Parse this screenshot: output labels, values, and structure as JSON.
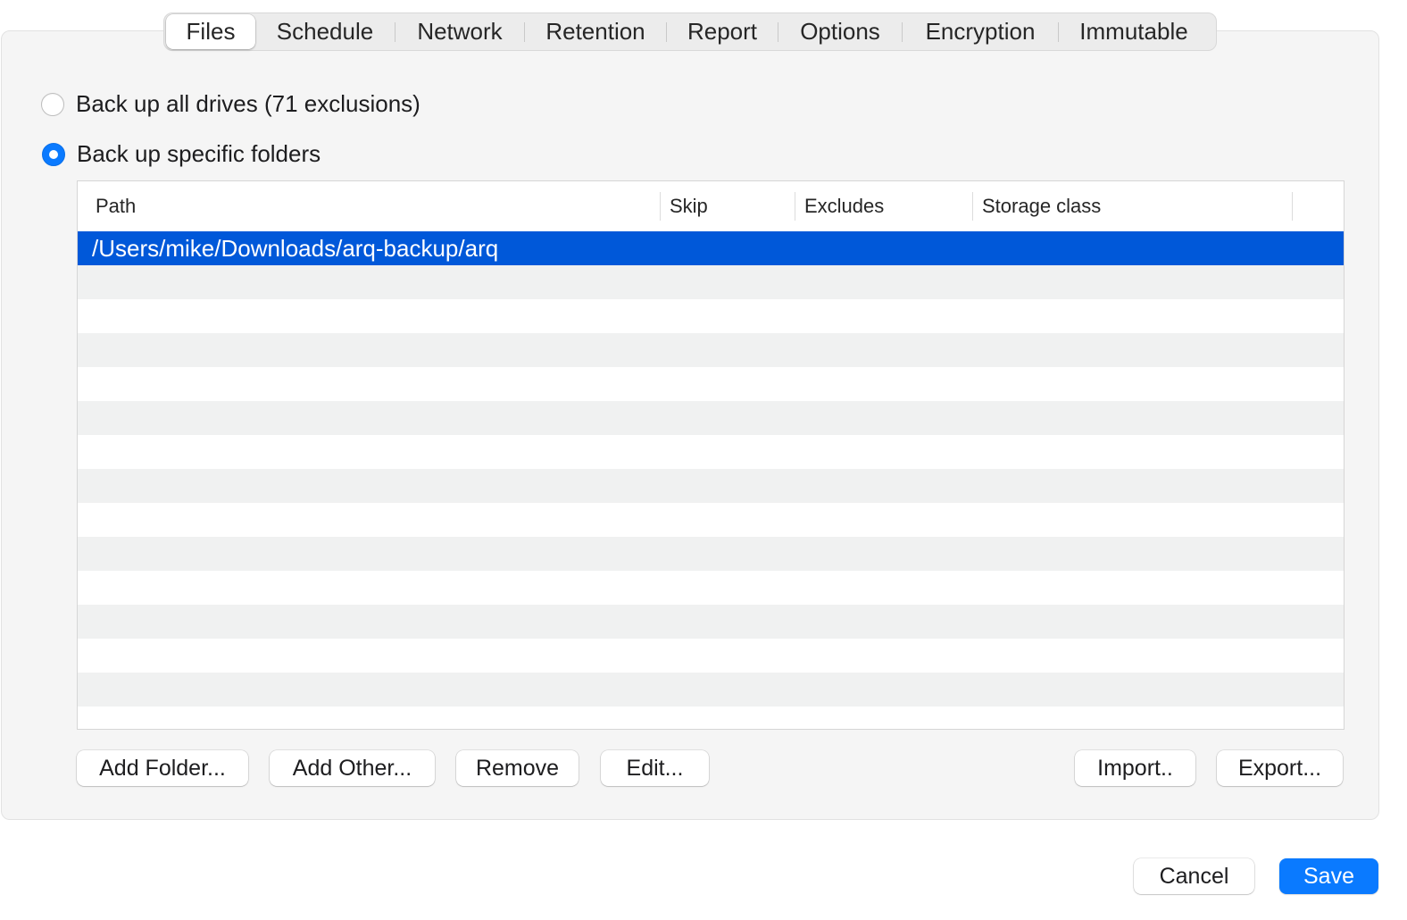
{
  "tabs": [
    {
      "label": "Files",
      "selected": true
    },
    {
      "label": "Schedule",
      "selected": false
    },
    {
      "label": "Network",
      "selected": false
    },
    {
      "label": "Retention",
      "selected": false
    },
    {
      "label": "Report",
      "selected": false
    },
    {
      "label": "Options",
      "selected": false
    },
    {
      "label": "Encryption",
      "selected": false
    },
    {
      "label": "Immutable",
      "selected": false
    }
  ],
  "backup_mode": {
    "all_drives_label": "Back up all drives (71 exclusions)",
    "specific_folders_label": "Back up specific folders",
    "selected": "specific_folders"
  },
  "table": {
    "columns": [
      "Path",
      "Skip",
      "Excludes",
      "Storage class"
    ],
    "rows": [
      {
        "path": "/Users/mike/Downloads/arq-backup/arq",
        "skip": "",
        "excludes": "",
        "storage_class": "",
        "selected": true
      }
    ]
  },
  "buttons": {
    "add_folder": "Add Folder...",
    "add_other": "Add Other...",
    "remove": "Remove",
    "edit": "Edit...",
    "import": "Import..",
    "export": "Export...",
    "cancel": "Cancel",
    "save": "Save"
  },
  "colors": {
    "accent": "#0a7aff",
    "selection": "#0058d9"
  }
}
